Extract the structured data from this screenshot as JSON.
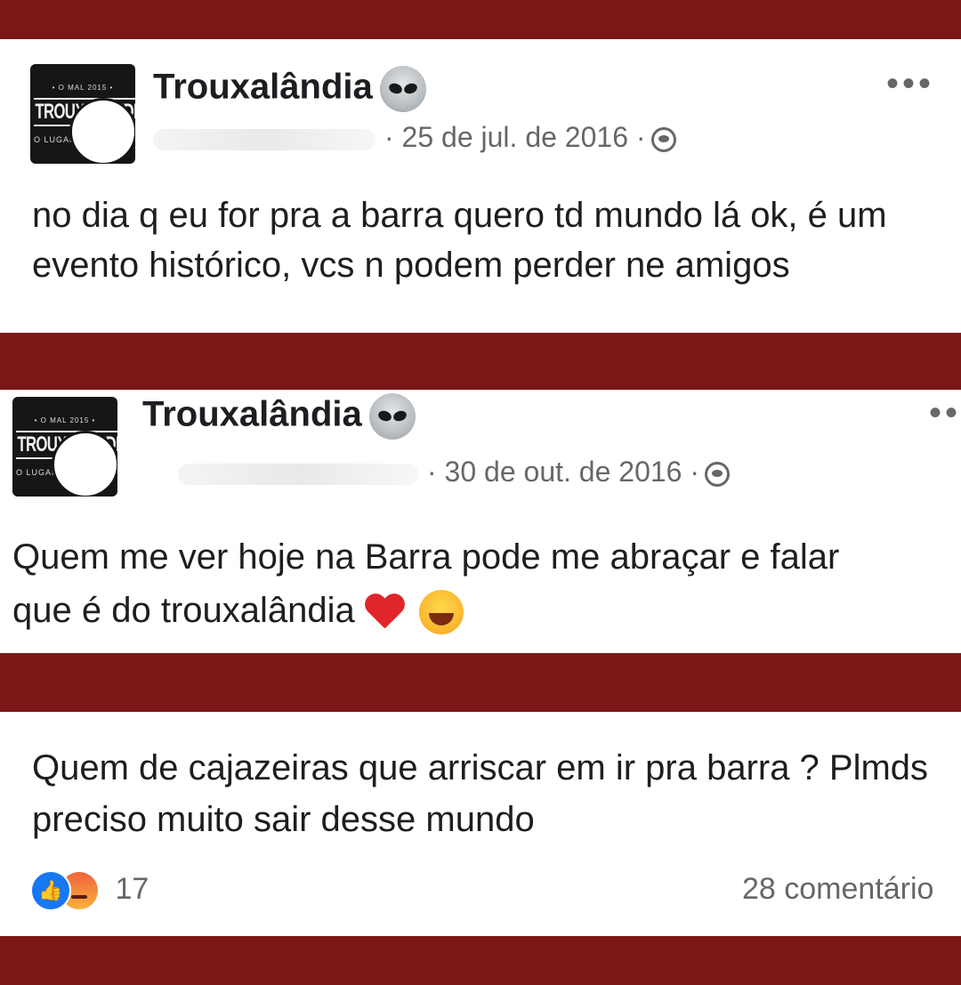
{
  "posts": [
    {
      "page_name": "Trouxalândia",
      "name_icon": "alien-icon",
      "date": "· 25 de jul. de 2016 ·",
      "privacy_icon": "friends-icon",
      "more_icon": "•••",
      "text": "no dia q eu for pra a barra quero td mundo lá ok, é um evento histórico, vcs n podem perder ne amigos",
      "avatar_logo": {
        "top": "• O MAL 2015 •",
        "mid": "TROUXALÂNDIA",
        "bot": "O LUGAR DE"
      }
    },
    {
      "page_name": "Trouxalândia",
      "name_icon": "alien-icon",
      "date": "· 30 de out. de 2016 ·",
      "privacy_icon": "friends-icon",
      "more_icon": "••",
      "text": "Quem me ver hoje na Barra pode me abraçar e falar que é do trouxalândia",
      "emojis": [
        "heart-emoji",
        "laughing-emoji"
      ],
      "avatar_logo": {
        "top": "• O MAL 2015 •",
        "mid": "TROUXALÂNDIA",
        "bot": "O LUGAR DE"
      }
    },
    {
      "text": "Quem de cajazeiras que arriscar em ir pra barra ? Plmds preciso muito sair desse mundo",
      "reactions": [
        "like-icon",
        "angry-icon"
      ],
      "reaction_count": "17",
      "comments": "28 comentário"
    }
  ],
  "colors": {
    "band": "#7a1717",
    "text": "#1c1e21",
    "meta": "#65676b",
    "like": "#1877f2"
  }
}
